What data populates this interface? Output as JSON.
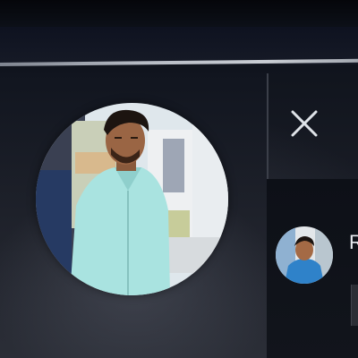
{
  "dialog": {
    "close_icon": "close-icon",
    "main_avatar": "profile-photo",
    "contact": {
      "name": "R",
      "avatar": "contact-photo"
    }
  },
  "colors": {
    "background": "#1a1d26",
    "divider": "#b7bcc5",
    "close_icon": "#dfe3e8",
    "name_text": "#e8ebf0",
    "shirt": "#a9e3e0",
    "photo_background": "#dfe7ec"
  }
}
